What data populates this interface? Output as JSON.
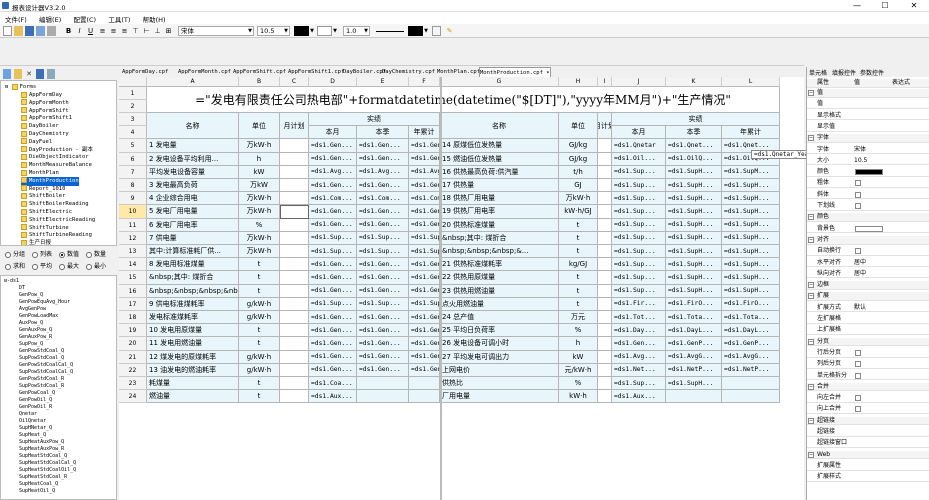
{
  "app": {
    "title": "报表设计器V3.2.0",
    "minimize": "—",
    "maximize": "☐",
    "close": "✕"
  },
  "menu": [
    "文件(F)",
    "编辑(E)",
    "配置(C)",
    "工具(T)",
    "帮助(H)"
  ],
  "toolbar": {
    "font": "宋体",
    "size": "10.5",
    "line_width": "1.0"
  },
  "tree": {
    "root": "Forms",
    "items": [
      "AppFormDay",
      "AppFormMonth",
      "AppFormShift",
      "AppFormShift1",
      "DayBoiler",
      "DayChemistry",
      "DayFuel",
      "DayProduction - 副本",
      "DieObjectIndicator",
      "MonthMeasureBalance",
      "MonthPlan",
      "MonthProduction",
      "Report_1010",
      "ShiftBoiler",
      "ShiftBoilerReading",
      "ShiftElectric",
      "ShiftElectricReading",
      "ShiftTurbine",
      "ShiftTurbineReading",
      "生产日报"
    ],
    "selected_index": 11
  },
  "radios": {
    "row1": [
      "分组",
      "列表",
      "数值",
      "数量"
    ],
    "row2": [
      "求和",
      "平均",
      "最大",
      "最小"
    ],
    "selected": "数值"
  },
  "fields": {
    "root": "ds1",
    "items": [
      "DT",
      "GenPow_Q",
      "GenPowEquAvg_Hour",
      "AvgGenPow",
      "GenPowLoadMax",
      "AuxPow_Q",
      "GenAuxPow_Q",
      "GenAuxPow_R",
      "SupPow_Q",
      "GenPowStdCoal_Q",
      "SupPowStdCoal_Q",
      "GenPowStdCoalCal_Q",
      "SupPowStdCoalCal_Q",
      "GenPowStdCoal_R",
      "SupPowStdCoal_R",
      "GenPowCoal_Q",
      "GenPowOil_Q",
      "GenPowOil_R",
      "Qnetar",
      "OilQnetar",
      "SupHNetar_Q",
      "SupHeat_Q",
      "SupHeatAuxPow_Q",
      "SupHeatAuxPow_R",
      "SupHeatStdCoal_Q",
      "SupHeatStdCoalCal_Q",
      "SupHeatStdCoalOil_Q",
      "SupHeatStdCoal_R",
      "SupHeatCoal_Q",
      "SupHeatOil_Q"
    ]
  },
  "tabs": [
    "AppFormDay.cpf",
    "AppFormMonth.cpf",
    "AppFormShift.cpf",
    "AppFormShift1.cpf",
    "DayBoiler.cpf",
    "DayChemistry.cpf",
    "MonthPlan.cpf",
    "MonthProduction.cpf ▾"
  ],
  "active_tab": 7,
  "sheet": {
    "columns": [
      "A",
      "B",
      "C",
      "D",
      "E",
      "F",
      "G",
      "H",
      "I",
      "J",
      "K",
      "L"
    ],
    "title": "=\"发电有限责任公司热电部\"+formatdatetime(datetime(\"$[DT]\"),\"yyyy年MM月\")+\"生产情况\"",
    "h_name": "名称",
    "h_unit": "单位",
    "h_plan": "月计划",
    "h_actual": "实绩",
    "h_month": "本月",
    "h_season": "本季",
    "h_year": "年累计",
    "rows": [
      [
        "1 发电量",
        "万kW·h",
        "",
        "=ds1.Gen...",
        "=ds1.Gen...",
        "=ds1.Gen...",
        "14 原煤低位发热量",
        "GJ/kg",
        "",
        "=ds1.Qnetar",
        "=ds1.Qnet...",
        "=ds1.Qnet..."
      ],
      [
        "2 发电设备平均利用...",
        "h",
        "",
        "=ds1.Gen...",
        "=ds1.Gen...",
        "=ds1.Gen...",
        "15 燃油低位发热量",
        "GJ/kg",
        "",
        "=ds1.Oil...",
        "=ds1.OilQ...",
        "=ds1.OilQ..."
      ],
      [
        "  平均发电设备容量",
        "kW",
        "",
        "=ds1.Avg...",
        "=ds1.Avg...",
        "=ds1.Avg...",
        "16 供热最高负荷:供汽量",
        "t/h",
        "",
        "=ds1.Sup...",
        "=ds1.SupH...",
        "=ds1.SupM..."
      ],
      [
        "3 发电最高负荷",
        "万kW",
        "",
        "=ds1.Gen...",
        "=ds1.Gen...",
        "=ds1.Gen...",
        "17 供热量",
        "GJ",
        "",
        "=ds1.Sup...",
        "=ds1.SupH...",
        "=ds1.SupH..."
      ],
      [
        "4 企业综合用电",
        "万kW·h",
        "",
        "=ds1.Com...",
        "=ds1.Com...",
        "=ds1.Com...",
        "18 供热厂用电量",
        "万kW·h",
        "",
        "=ds1.Sup...",
        "=ds1.SupH...",
        "=ds1.SupH..."
      ],
      [
        "5 发电厂用电量",
        "万kW·h",
        "",
        "=ds1.Gen...",
        "=ds1.Gen...",
        "=ds1.Gen...",
        "19 供热厂用电率",
        "kW·h/GJ",
        "",
        "=ds1.Sup...",
        "=ds1.SupH...",
        "=ds1.SupH..."
      ],
      [
        "6 发电厂用电率",
        "%",
        "",
        "=ds1.Gen...",
        "=ds1.Gen...",
        "=ds1.Gen...",
        "20 供热标准煤量",
        "t",
        "",
        "=ds1.Sup...",
        "=ds1.SupH...",
        "=ds1.SupH..."
      ],
      [
        "7 供电量",
        "万kW·h",
        "",
        "=ds1.Sup...",
        "=ds1.Sup...",
        "=ds1.Sup...",
        "&nbsp;其中: 煤折合",
        "t",
        "",
        "=ds1.Sup...",
        "=ds1.SupH...",
        "=ds1.SupH..."
      ],
      [
        "其中:计算标准耗厂供...",
        "万kW·h",
        "",
        "=ds1.Sup...",
        "=ds1.Sup...",
        "=ds1.Sup...",
        "&nbsp;&nbsp;&nbsp;&...",
        "t",
        "",
        "=ds1.Sup...",
        "=ds1.SupH...",
        "=ds1.SupH..."
      ],
      [
        "8 发电用标准煤量",
        "t",
        "",
        "=ds1.Gen...",
        "=ds1.Gen...",
        "=ds1.Gen...",
        "21 供热标准煤耗率",
        "kg/GJ",
        "",
        "=ds1.Sup...",
        "=ds1.SupH...",
        "=ds1.SupH..."
      ],
      [
        "&nbsp;其中: 煤折合",
        "t",
        "",
        "=ds1.Gen...",
        "=ds1.Gen...",
        "=ds1.Gen...",
        "22 供热用原煤量",
        "t",
        "",
        "=ds1.Sup...",
        "=ds1.SupH...",
        "=ds1.SupH..."
      ],
      [
        "&nbsp;&nbsp;&nbsp;&nbsp;&...",
        "t",
        "",
        "=ds1.Gen...",
        "=ds1.Gen...",
        "=ds1.Gen...",
        "23 供热用燃油量",
        "t",
        "",
        "=ds1.Sup...",
        "=ds1.SupH...",
        "=ds1.SupH..."
      ],
      [
        "9 供电标准煤耗率",
        "g/kW·h",
        "",
        "=ds1.Sup...",
        "=ds1.Sup...",
        "=ds1.Sup...",
        "  点火用燃油量",
        "t",
        "",
        "=ds1.Fir...",
        "=ds1.FirO...",
        "=ds1.FirO..."
      ],
      [
        "  发电标准煤耗率",
        "g/kW·h",
        "",
        "=ds1.Gen...",
        "=ds1.Gen...",
        "=ds1.Gen...",
        "24 总产值",
        "万元",
        "",
        "=ds1.Tot...",
        "=ds1.Tota...",
        "=ds1.Tota..."
      ],
      [
        "10 发电用原煤量",
        "t",
        "",
        "=ds1.Gen...",
        "=ds1.Gen...",
        "=ds1.Gen...",
        "25 平均日负荷率",
        "%",
        "",
        "=ds1.Day...",
        "=ds1.DayL...",
        "=ds1.DayL..."
      ],
      [
        "11 发电用燃油量",
        "t",
        "",
        "=ds1.Gen...",
        "=ds1.Gen...",
        "=ds1.Gen...",
        "26 发电设备可调小时",
        "h",
        "",
        "=ds1.Gen...",
        "=ds1.GenP...",
        "=ds1.GenP..."
      ],
      [
        "12 煤发电的原煤耗率",
        "g/kW·h",
        "",
        "=ds1.Gen...",
        "=ds1.Gen...",
        "=ds1.Gen...",
        "27 平均发电可调出力",
        "kW",
        "",
        "=ds1.Avg...",
        "=ds1.AvgG...",
        "=ds1.AvgG..."
      ],
      [
        "13 油发电的燃油耗率",
        "g/kW·h",
        "",
        "=ds1.Gen...",
        "=ds1.Gen...",
        "=ds1.Gen...",
        "  上网电价",
        "元/kW·h",
        "",
        "=ds1.Net...",
        "=ds1.NetP...",
        "=ds1.NetP..."
      ],
      [
        "  耗煤量",
        "t",
        "",
        "=ds1.Coa...",
        "",
        "",
        "  供热比",
        "%",
        "",
        "=ds1.Sup...",
        "=ds1.SupH...",
        ""
      ],
      [
        "  燃油量",
        "t",
        "",
        "=ds1.Aux...",
        "",
        "",
        "  厂用电量",
        "kW·h",
        "",
        "=ds1.Aux...",
        "",
        ""
      ]
    ]
  },
  "tooltip": "=ds1.Qnetar_Year",
  "props": {
    "tabs": [
      "单元格",
      "填报控件",
      "参数控件"
    ],
    "header": [
      "属性",
      "值",
      "表达式"
    ],
    "rows": [
      {
        "k": "值",
        "v": "",
        "g": "group"
      },
      {
        "k": "值",
        "v": ""
      },
      {
        "k": "显示格式",
        "v": ""
      },
      {
        "k": "显示值",
        "v": ""
      },
      {
        "k": "字体",
        "v": "",
        "g": "group"
      },
      {
        "k": "字体",
        "v": "宋体"
      },
      {
        "k": "大小",
        "v": "10.5"
      },
      {
        "k": "颜色",
        "v": "",
        "t": "swatch",
        "color": "#000000"
      },
      {
        "k": "粗体",
        "v": "",
        "t": "cb"
      },
      {
        "k": "斜体",
        "v": "",
        "t": "cb"
      },
      {
        "k": "下划线",
        "v": "",
        "t": "cb"
      },
      {
        "k": "颜色",
        "v": "",
        "g": "group"
      },
      {
        "k": "背景色",
        "v": "",
        "t": "swatch",
        "color": "#ffffff"
      },
      {
        "k": "对齐",
        "v": "",
        "g": "group"
      },
      {
        "k": "自动换行",
        "v": "",
        "t": "cb"
      },
      {
        "k": "水平对齐",
        "v": "居中"
      },
      {
        "k": "纵向对齐",
        "v": "居中"
      },
      {
        "k": "边框",
        "v": "",
        "g": "group"
      },
      {
        "k": "扩展",
        "v": "",
        "g": "group"
      },
      {
        "k": "扩展方式",
        "v": "默认"
      },
      {
        "k": "左扩展格",
        "v": ""
      },
      {
        "k": "上扩展格",
        "v": ""
      },
      {
        "k": "分页",
        "v": "",
        "g": "group"
      },
      {
        "k": "行后分页",
        "v": "",
        "t": "cb"
      },
      {
        "k": "列后分页",
        "v": "",
        "t": "cb"
      },
      {
        "k": "单元格拆分",
        "v": "",
        "t": "cb"
      },
      {
        "k": "合并",
        "v": "",
        "g": "group"
      },
      {
        "k": "向左合并",
        "v": "",
        "t": "cb"
      },
      {
        "k": "向上合并",
        "v": "",
        "t": "cb"
      },
      {
        "k": "超链接",
        "v": "",
        "g": "group"
      },
      {
        "k": "超链接",
        "v": ""
      },
      {
        "k": "超链接窗口",
        "v": ""
      },
      {
        "k": "Web",
        "v": "",
        "g": "group"
      },
      {
        "k": "扩展属性",
        "v": ""
      },
      {
        "k": "扩展样式",
        "v": ""
      }
    ]
  }
}
